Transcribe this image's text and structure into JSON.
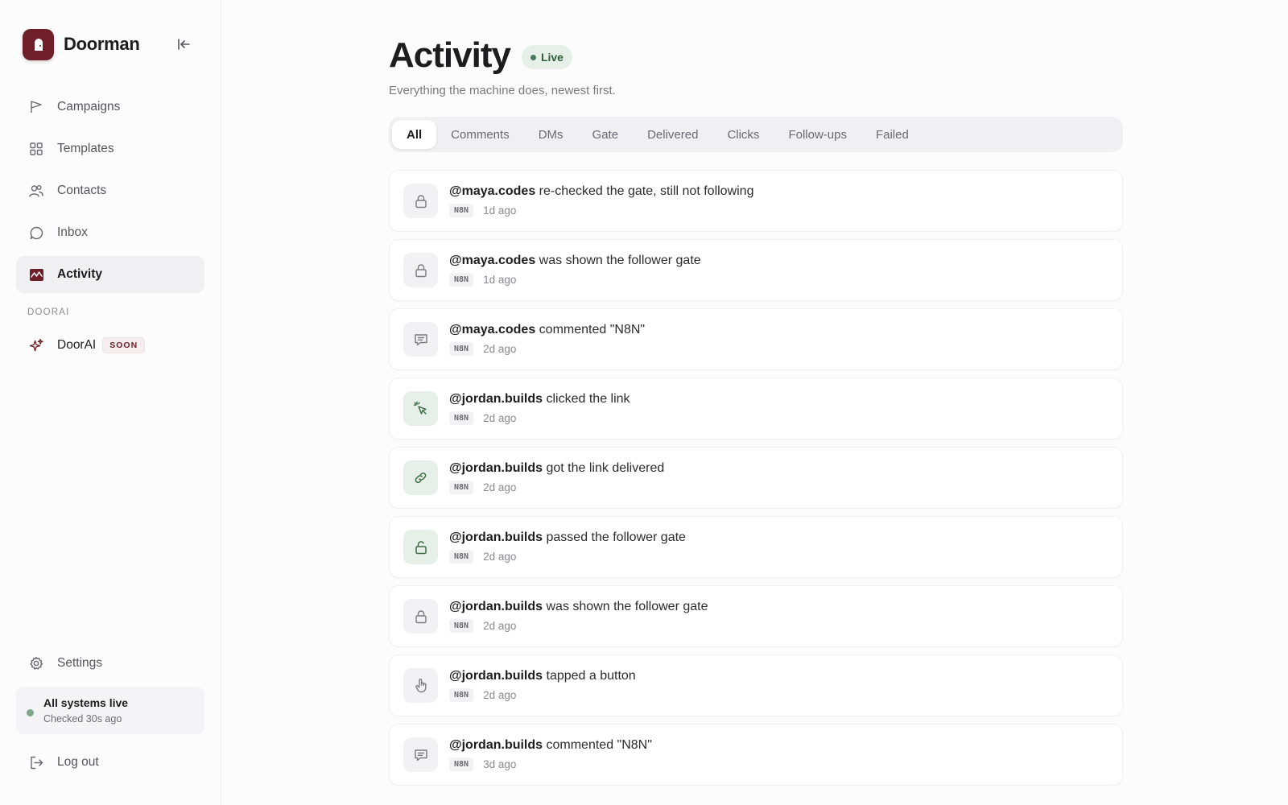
{
  "brand": {
    "name": "Doorman",
    "logo_color": "#6e1f2a"
  },
  "sidebar": {
    "items": [
      {
        "label": "Campaigns",
        "icon": "flag-icon"
      },
      {
        "label": "Templates",
        "icon": "grid-icon"
      },
      {
        "label": "Contacts",
        "icon": "users-icon"
      },
      {
        "label": "Inbox",
        "icon": "chat-bubble-icon"
      },
      {
        "label": "Activity",
        "icon": "activity-icon",
        "active": true
      }
    ],
    "section_label": "DOORAI",
    "doorai": {
      "label": "DoorAI",
      "badge": "SOON",
      "icon": "sparkle-icon"
    },
    "settings_label": "Settings",
    "status": {
      "title": "All systems live",
      "subtitle": "Checked 30s ago",
      "color": "#7fa68a"
    },
    "logout_label": "Log out"
  },
  "page": {
    "title": "Activity",
    "live_badge": "Live",
    "subtitle": "Everything the machine does, newest first."
  },
  "tabs": [
    "All",
    "Comments",
    "DMs",
    "Gate",
    "Delivered",
    "Clicks",
    "Follow-ups",
    "Failed"
  ],
  "active_tab": "All",
  "feed": [
    {
      "handle": "@maya.codes",
      "text": " re-checked the gate, still not following",
      "tag": "N8N",
      "time": "1d ago",
      "icon": "lock-icon"
    },
    {
      "handle": "@maya.codes",
      "text": " was shown the follower gate",
      "tag": "N8N",
      "time": "1d ago",
      "icon": "lock-icon"
    },
    {
      "handle": "@maya.codes",
      "text": " commented \"N8N\"",
      "tag": "N8N",
      "time": "2d ago",
      "icon": "comment-icon"
    },
    {
      "handle": "@jordan.builds",
      "text": " clicked the link",
      "tag": "N8N",
      "time": "2d ago",
      "icon": "cursor-click-icon"
    },
    {
      "handle": "@jordan.builds",
      "text": " got the link delivered",
      "tag": "N8N",
      "time": "2d ago",
      "icon": "link-icon"
    },
    {
      "handle": "@jordan.builds",
      "text": " passed the follower gate",
      "tag": "N8N",
      "time": "2d ago",
      "icon": "unlock-icon"
    },
    {
      "handle": "@jordan.builds",
      "text": " was shown the follower gate",
      "tag": "N8N",
      "time": "2d ago",
      "icon": "lock-icon"
    },
    {
      "handle": "@jordan.builds",
      "text": " tapped a button",
      "tag": "N8N",
      "time": "2d ago",
      "icon": "hand-tap-icon"
    },
    {
      "handle": "@jordan.builds",
      "text": " commented \"N8N\"",
      "tag": "N8N",
      "time": "3d ago",
      "icon": "comment-icon"
    }
  ]
}
